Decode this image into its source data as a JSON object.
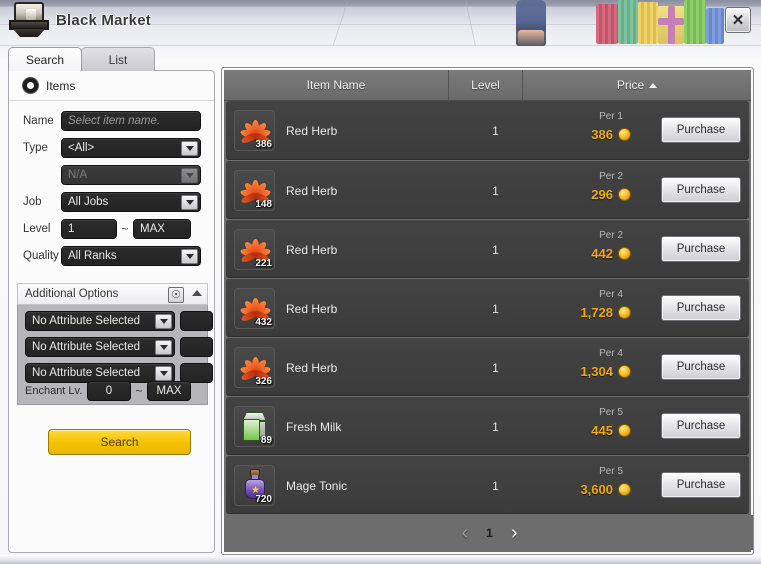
{
  "window": {
    "title": "Black Market",
    "icon": "chest-icon",
    "close_label": "✕"
  },
  "tabs": [
    {
      "label": "Search",
      "active": true
    },
    {
      "label": "List",
      "active": false
    }
  ],
  "search_panel": {
    "items_radio_label": "Items",
    "fields": {
      "name": {
        "label": "Name",
        "placeholder": "Select item name.",
        "value": ""
      },
      "type": {
        "label": "Type",
        "value": "<All>"
      },
      "subtype": {
        "label": "",
        "value": "N/A",
        "disabled": true
      },
      "job": {
        "label": "Job",
        "value": "All Jobs"
      },
      "level": {
        "label": "Level",
        "min": "1",
        "max": "MAX",
        "separator": "~"
      },
      "quality": {
        "label": "Quality",
        "value": "All Ranks"
      }
    },
    "additional_options": {
      "title": "Additional Options",
      "refresh_icon": "refresh-icon",
      "collapse_icon": "chevron-up-icon",
      "attributes": [
        {
          "value": "No Attribute Selected",
          "amount": ""
        },
        {
          "value": "No Attribute Selected",
          "amount": ""
        },
        {
          "value": "No Attribute Selected",
          "amount": ""
        }
      ],
      "enchant": {
        "label": "Enchant Lv.",
        "min": "0",
        "max": "MAX",
        "separator": "~"
      }
    },
    "search_button": "Search"
  },
  "listing": {
    "columns": [
      {
        "key": "name",
        "label": "Item Name",
        "sorted": false
      },
      {
        "key": "level",
        "label": "Level",
        "sorted": false
      },
      {
        "key": "price",
        "label": "Price",
        "sorted": true,
        "sort_dir": "asc"
      }
    ],
    "purchase_label": "Purchase",
    "rows": [
      {
        "icon": "herb-icon",
        "count": "386",
        "name": "Red Herb",
        "level": "1",
        "per": "Per 1",
        "price": "386",
        "currency": "gold-coin"
      },
      {
        "icon": "herb-icon",
        "count": "148",
        "name": "Red Herb",
        "level": "1",
        "per": "Per 2",
        "price": "296",
        "currency": "gold-coin"
      },
      {
        "icon": "herb-icon",
        "count": "221",
        "name": "Red Herb",
        "level": "1",
        "per": "Per 2",
        "price": "442",
        "currency": "gold-coin"
      },
      {
        "icon": "herb-icon",
        "count": "432",
        "name": "Red Herb",
        "level": "1",
        "per": "Per 4",
        "price": "1,728",
        "currency": "gold-coin"
      },
      {
        "icon": "herb-icon",
        "count": "326",
        "name": "Red Herb",
        "level": "1",
        "per": "Per 4",
        "price": "1,304",
        "currency": "gold-coin"
      },
      {
        "icon": "milk-icon",
        "count": "89",
        "name": "Fresh Milk",
        "level": "1",
        "per": "Per 5",
        "price": "445",
        "currency": "gold-coin"
      },
      {
        "icon": "tonic-icon",
        "count": "720",
        "name": "Mage Tonic",
        "level": "1",
        "per": "Per 5",
        "price": "3,600",
        "currency": "gold-coin"
      }
    ],
    "pager": {
      "prev": "‹",
      "next": "›",
      "current_page": "1"
    }
  },
  "colors": {
    "accent_gold": "#f0a818",
    "search_button": "#f5c200",
    "panel_dark": "#232323",
    "listing_bg": "#6d6d6d",
    "row_bg": "#3f3f3f"
  }
}
